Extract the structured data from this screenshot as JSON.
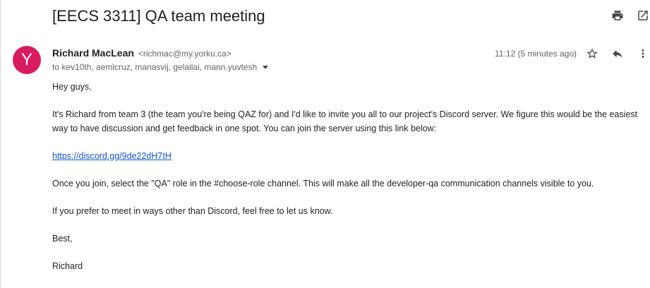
{
  "email": {
    "subject": "[EECS 3311] QA team meeting",
    "avatar_letter": "Y",
    "sender_name": "Richard MacLean",
    "sender_email": "<richmac@my.yorku.ca>",
    "recipients": "to kev10th, aemlcruz, manasvij, gelailai, mann.yuvtesh",
    "timestamp": "11:12 (5 minutes ago)",
    "body": {
      "greeting": "Hey guys,",
      "paragraph_1": "It's Richard from team 3 (the team you're being QAZ for) and I'd like to invite you all to our project's Discord server. We figure this would be the easiest way to have discussion and get feedback in one spot. You can join the server using this link below:",
      "link": "https://discord.gg/9de22dH7tH",
      "paragraph_2": "Once you join, select the \"QA\" role in the #choose-role channel. This will make all the developer-qa communication channels visible to you.",
      "paragraph_3": "If you prefer to meet in ways other than Discord, feel free to let us know.",
      "closing": "Best,",
      "signature": "Richard"
    }
  },
  "icons": {
    "print": "print-icon",
    "open_new_window": "open-in-new-window-icon",
    "star": "star-icon",
    "reply": "reply-icon",
    "more": "more-vertical-icon"
  },
  "colors": {
    "avatar_bg": "#d81b60",
    "link": "#1155cc",
    "muted_text": "#5f6368"
  }
}
